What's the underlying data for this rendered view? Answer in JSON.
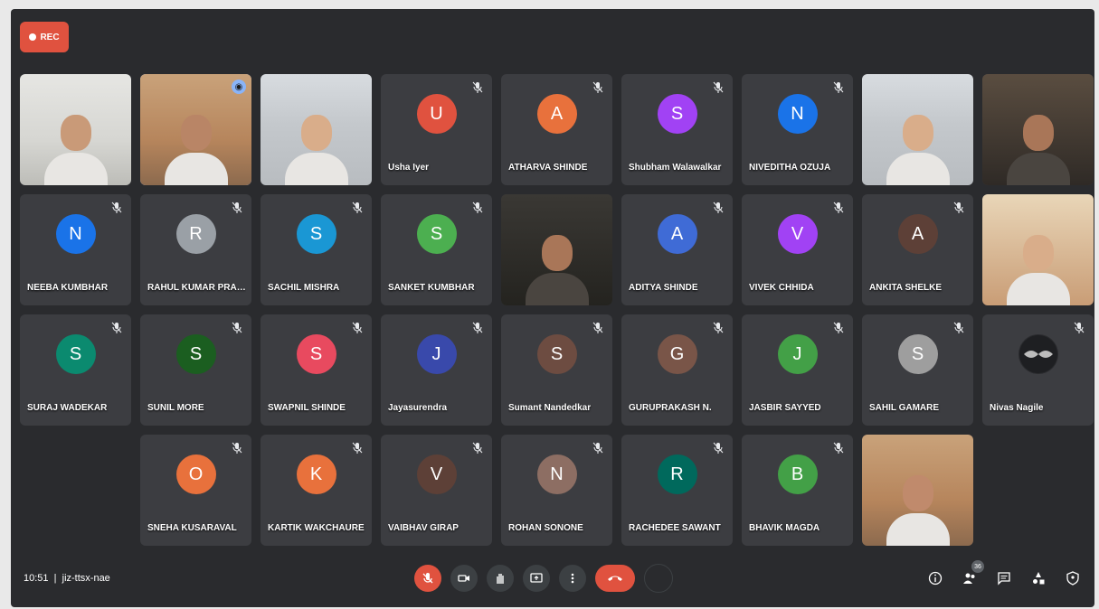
{
  "recording": {
    "label": "REC"
  },
  "footer": {
    "time": "10:51",
    "meeting_code": "jiz-ttsx-nae",
    "people_count": "36"
  },
  "tiles": [
    {
      "type": "video",
      "name": "",
      "scene": "v-office"
    },
    {
      "type": "video",
      "name": "",
      "scene": "v-room",
      "pinned": true
    },
    {
      "type": "video",
      "name": "",
      "scene": "v-light"
    },
    {
      "type": "avatar",
      "name": "Usha Iyer",
      "initial": "U",
      "color": "#e0523f"
    },
    {
      "type": "avatar",
      "name": "ATHARVA SHINDE",
      "initial": "A",
      "color": "#e8713c"
    },
    {
      "type": "avatar",
      "name": "Shubham Walawalkar",
      "initial": "S",
      "color": "#a142f4"
    },
    {
      "type": "avatar",
      "name": "NIVEDITHA OZUJA",
      "initial": "N",
      "color": "#1a73e8"
    },
    {
      "type": "video",
      "name": "",
      "scene": "v-light"
    },
    {
      "type": "video",
      "name": "",
      "scene": "v-dark2"
    },
    {
      "type": "avatar",
      "name": "NEEBA KUMBHAR",
      "initial": "N",
      "color": "#1a73e8"
    },
    {
      "type": "avatar",
      "name": "RAHUL KUMAR PRASAD",
      "initial": "R",
      "color": "#9aa0a6"
    },
    {
      "type": "avatar",
      "name": "SACHIL MISHRA",
      "initial": "S",
      "color": "#1a97d4"
    },
    {
      "type": "avatar",
      "name": "SANKET KUMBHAR",
      "initial": "S",
      "color": "#4caf50"
    },
    {
      "type": "video",
      "name": "",
      "scene": "v-dark"
    },
    {
      "type": "avatar",
      "name": "ADITYA SHINDE",
      "initial": "A",
      "color": "#3f6bd6"
    },
    {
      "type": "avatar",
      "name": "VIVEK CHHIDA",
      "initial": "V",
      "color": "#a142f4"
    },
    {
      "type": "avatar",
      "name": "ANKITA SHELKE",
      "initial": "A",
      "color": "#5d4037"
    },
    {
      "type": "video",
      "name": "",
      "scene": "v-warm"
    },
    {
      "type": "avatar",
      "name": "SURAJ WADEKAR",
      "initial": "S",
      "color": "#0b8a6f"
    },
    {
      "type": "avatar",
      "name": "SUNIL MORE",
      "initial": "S",
      "color": "#1b5e20"
    },
    {
      "type": "avatar",
      "name": "SWAPNIL SHINDE",
      "initial": "S",
      "color": "#e84a5f"
    },
    {
      "type": "avatar",
      "name": "Jayasurendra",
      "initial": "J",
      "color": "#3949ab"
    },
    {
      "type": "avatar",
      "name": "Sumant Nandedkar",
      "initial": "S",
      "color": "#6d4c41"
    },
    {
      "type": "avatar",
      "name": "GURUPRAKASH N.",
      "initial": "G",
      "color": "#795548"
    },
    {
      "type": "avatar",
      "name": "JASBIR SAYYED",
      "initial": "J",
      "color": "#43a047"
    },
    {
      "type": "avatar",
      "name": "SAHIL GAMARE",
      "initial": "S",
      "color": "#9e9e9e"
    },
    {
      "type": "avatar",
      "name": "Nivas Nagile",
      "initial": "",
      "color": "#2a2b2e"
    },
    {
      "type": "empty"
    },
    {
      "type": "avatar",
      "name": "SNEHA KUSARAVAL",
      "initial": "O",
      "color": "#e8713c"
    },
    {
      "type": "avatar",
      "name": "KARTIK WAKCHAURE",
      "initial": "K",
      "color": "#e8713c"
    },
    {
      "type": "avatar",
      "name": "VAIBHAV GIRAP",
      "initial": "V",
      "color": "#5d4037"
    },
    {
      "type": "avatar",
      "name": "ROHAN SONONE",
      "initial": "N",
      "color": "#8d6e63"
    },
    {
      "type": "avatar",
      "name": "RACHEDEE SAWANT",
      "initial": "R",
      "color": "#00695c"
    },
    {
      "type": "avatar",
      "name": "BHAVIK MAGDA",
      "initial": "B",
      "color": "#43a047"
    },
    {
      "type": "video",
      "name": "",
      "scene": "v-room"
    },
    {
      "type": "empty"
    }
  ],
  "controls": {
    "mic_icon": "mic-icon",
    "camera_icon": "camera-icon",
    "hand_icon": "raise-hand-icon",
    "present_icon": "present-icon",
    "more_icon": "more-icon",
    "end_icon": "end-call-icon"
  },
  "right_controls": [
    "info-icon",
    "people-icon",
    "chat-icon",
    "activities-icon",
    "host-controls-icon"
  ]
}
